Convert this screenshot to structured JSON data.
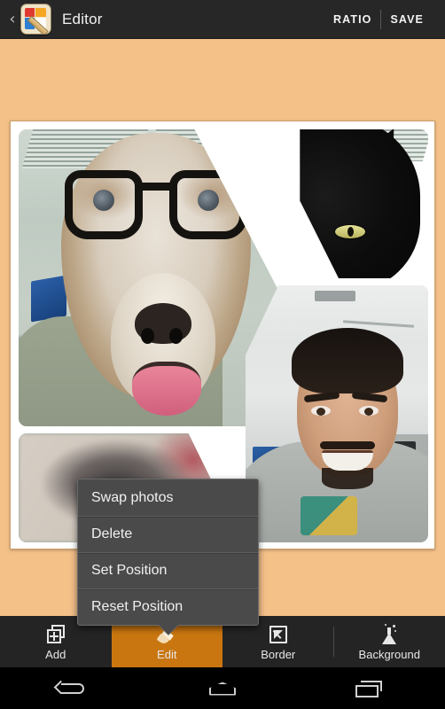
{
  "topbar": {
    "back_icon": "back-chevron-icon",
    "app_icon": "app-logo-icon",
    "title": "Editor",
    "ratio_label": "RATIO",
    "save_label": "SAVE"
  },
  "canvas": {
    "background_color": "#F4C189",
    "frame_color": "#FFFFFF",
    "cells": [
      {
        "name": "dog-with-glasses",
        "description": "Grey dog face wearing black glasses over a person in an office"
      },
      {
        "name": "black-dog",
        "description": "Black dog face with yellow eyes"
      },
      {
        "name": "man-selfie",
        "description": "Smiling man with moustache in an office"
      },
      {
        "name": "blurry-dog",
        "description": "Blurred close-up photo"
      }
    ]
  },
  "context_menu": {
    "items": [
      {
        "label": "Swap photos"
      },
      {
        "label": "Delete"
      },
      {
        "label": "Set Position"
      },
      {
        "label": "Reset Position"
      }
    ]
  },
  "tabbar": {
    "active_color": "#C97610",
    "tabs": [
      {
        "label": "Add",
        "icon": "add-photos-icon",
        "active": false
      },
      {
        "label": "Edit",
        "icon": "paintbrush-icon",
        "active": true
      },
      {
        "label": "Border",
        "icon": "border-icon",
        "active": false
      },
      {
        "label": "Background",
        "icon": "flask-icon",
        "active": false
      }
    ]
  },
  "navbar": {
    "buttons": [
      {
        "name": "back-icon"
      },
      {
        "name": "home-icon"
      },
      {
        "name": "recents-icon"
      }
    ]
  }
}
